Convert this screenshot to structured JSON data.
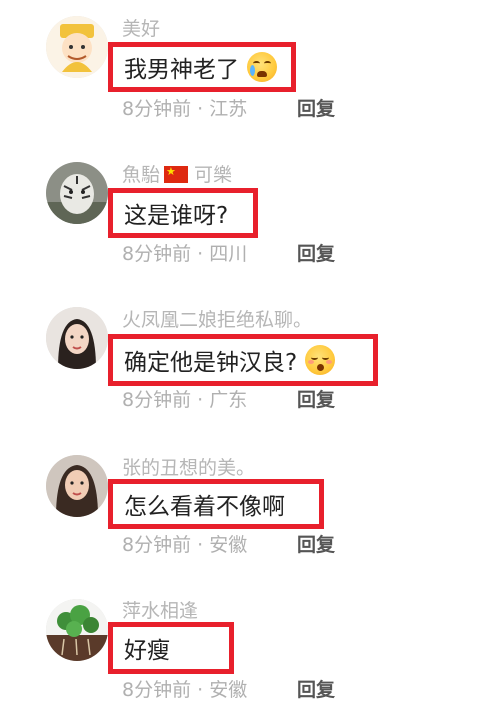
{
  "comments": [
    {
      "username": "美好",
      "text": "我男神老了",
      "emoji": "loudly-crying-face",
      "time": "8分钟前",
      "location": "江苏",
      "reply": "回复"
    },
    {
      "username_prefix": "魚駘",
      "flag": "china-flag-icon",
      "username_suffix": "可樂",
      "text": "这是谁呀?",
      "time": "8分钟前",
      "location": "四川",
      "reply": "回复"
    },
    {
      "username": "火凤凰二娘拒绝私聊。",
      "text": "确定他是钟汉良?",
      "emoji": "sleepy-face",
      "time": "8分钟前",
      "location": "广东",
      "reply": "回复"
    },
    {
      "username": "张的丑想的美。",
      "text": "怎么看着不像啊",
      "time": "8分钟前",
      "location": "安徽",
      "reply": "回复"
    },
    {
      "username": "萍水相逢",
      "text": "好瘦",
      "time": "8分钟前",
      "location": "安徽",
      "reply": "回复"
    }
  ],
  "separator": " · ",
  "colors": {
    "highlight_border": "#e8202c",
    "username": "#b6b6b6",
    "meta": "#b0b0b0",
    "reply": "#555555",
    "text": "#222222"
  }
}
